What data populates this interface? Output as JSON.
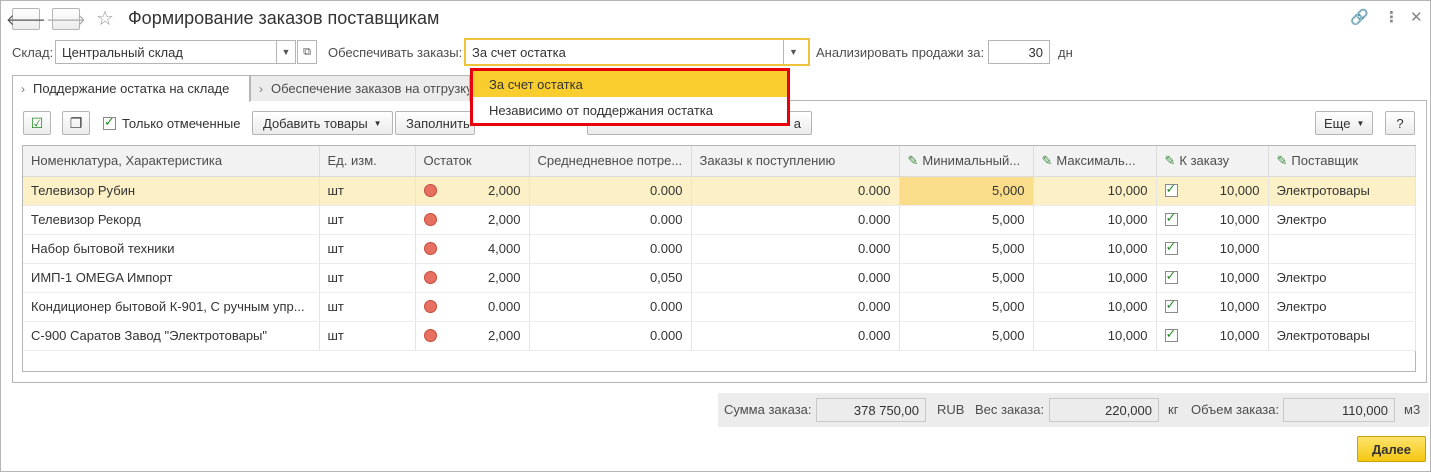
{
  "window": {
    "title": "Формирование заказов поставщикам"
  },
  "filters": {
    "warehouse_label": "Склад:",
    "warehouse_value": "Центральный склад",
    "provide_label": "Обеспечивать заказы:",
    "provide_value": "За счет остатка",
    "analyze_label": "Анализировать продажи за:",
    "analyze_value": "30",
    "analyze_unit": "дн"
  },
  "dropdown": {
    "options": [
      "За счет остатка",
      "Независимо от поддержания остатка"
    ],
    "selected": "За счет остатка"
  },
  "tabs": [
    {
      "label": "Поддержание остатка на складе"
    },
    {
      "label": "Обеспечение заказов на отгрузку"
    }
  ],
  "toolbar": {
    "only_marked": "Только отмеченные",
    "add_goods": "Добавить товары",
    "fill": "Заполнить",
    "more": "Еще",
    "help": "?",
    "partial_right": "а"
  },
  "table": {
    "columns": [
      "Номенклатура, Характеристика",
      "Ед. изм.",
      "Остаток",
      "Среднедневное потре...",
      "Заказы к поступлению",
      "Минимальный...",
      "Максималь...",
      "К заказу",
      "Поставщик"
    ],
    "rows": [
      {
        "name": "Телевизор Рубин",
        "unit": "шт",
        "stock": "2,000",
        "avg": "0.000",
        "incoming": "0.000",
        "min": "5,000",
        "max": "10,000",
        "order": "10,000",
        "supplier": "Электротовары"
      },
      {
        "name": "Телевизор Рекорд",
        "unit": "шт",
        "stock": "2,000",
        "avg": "0.000",
        "incoming": "0.000",
        "min": "5,000",
        "max": "10,000",
        "order": "10,000",
        "supplier": "Электро"
      },
      {
        "name": "Набор бытовой техники",
        "unit": "шт",
        "stock": "4,000",
        "avg": "0.000",
        "incoming": "0.000",
        "min": "5,000",
        "max": "10,000",
        "order": "10,000",
        "supplier": ""
      },
      {
        "name": "ИМП-1 OMEGA Импорт",
        "unit": "шт",
        "stock": "2,000",
        "avg": "0,050",
        "incoming": "0.000",
        "min": "5,000",
        "max": "10,000",
        "order": "10,000",
        "supplier": "Электро"
      },
      {
        "name": "Кондиционер бытовой К-901, С ручным упр...",
        "unit": "шт",
        "stock": "0.000",
        "avg": "0.000",
        "incoming": "0.000",
        "min": "5,000",
        "max": "10,000",
        "order": "10,000",
        "supplier": "Электро"
      },
      {
        "name": "С-900 Саратов Завод \"Электротовары\"",
        "unit": "шт",
        "stock": "2,000",
        "avg": "0.000",
        "incoming": "0.000",
        "min": "5,000",
        "max": "10,000",
        "order": "10,000",
        "supplier": "Электротовары"
      }
    ]
  },
  "footer": {
    "sum_label": "Сумма заказа:",
    "sum_value": "378 750,00",
    "sum_currency": "RUB",
    "weight_label": "Вес заказа:",
    "weight_value": "220,000",
    "weight_unit": "кг",
    "volume_label": "Объем заказа:",
    "volume_value": "110,000",
    "volume_unit": "м3"
  },
  "actions": {
    "next": "Далее"
  },
  "colors": {
    "accent_yellow": "#f9cd2e",
    "highlight_border": "#e8000b",
    "stock_dot": "#e87060"
  }
}
